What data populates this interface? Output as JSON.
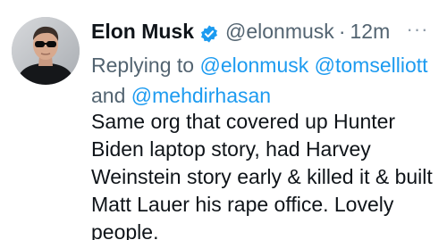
{
  "author": {
    "name": "Elon Musk",
    "handle": "@elonmusk",
    "separator": "·",
    "time": "12m",
    "verified_icon": "verified-badge-icon",
    "verified_color": "#1d9bf0",
    "avatar_icon": "profile-photo"
  },
  "reply": {
    "prefix": "Replying to",
    "mentions": [
      "@elonmusk",
      "@tomselliott",
      "@mehdirhasan"
    ],
    "conjunction": "and"
  },
  "tweet": {
    "lines": [
      "Same org that covered up Hunter",
      "Biden laptop story, had Harvey",
      "Weinstein story early & killed it & built",
      "Matt Lauer his rape office. Lovely",
      "people."
    ]
  },
  "menu": {
    "more_icon": "more-options-icon",
    "glyph": "···"
  },
  "colors": {
    "text": "#0f1419",
    "secondary": "#536471",
    "link": "#1d9bf0"
  }
}
